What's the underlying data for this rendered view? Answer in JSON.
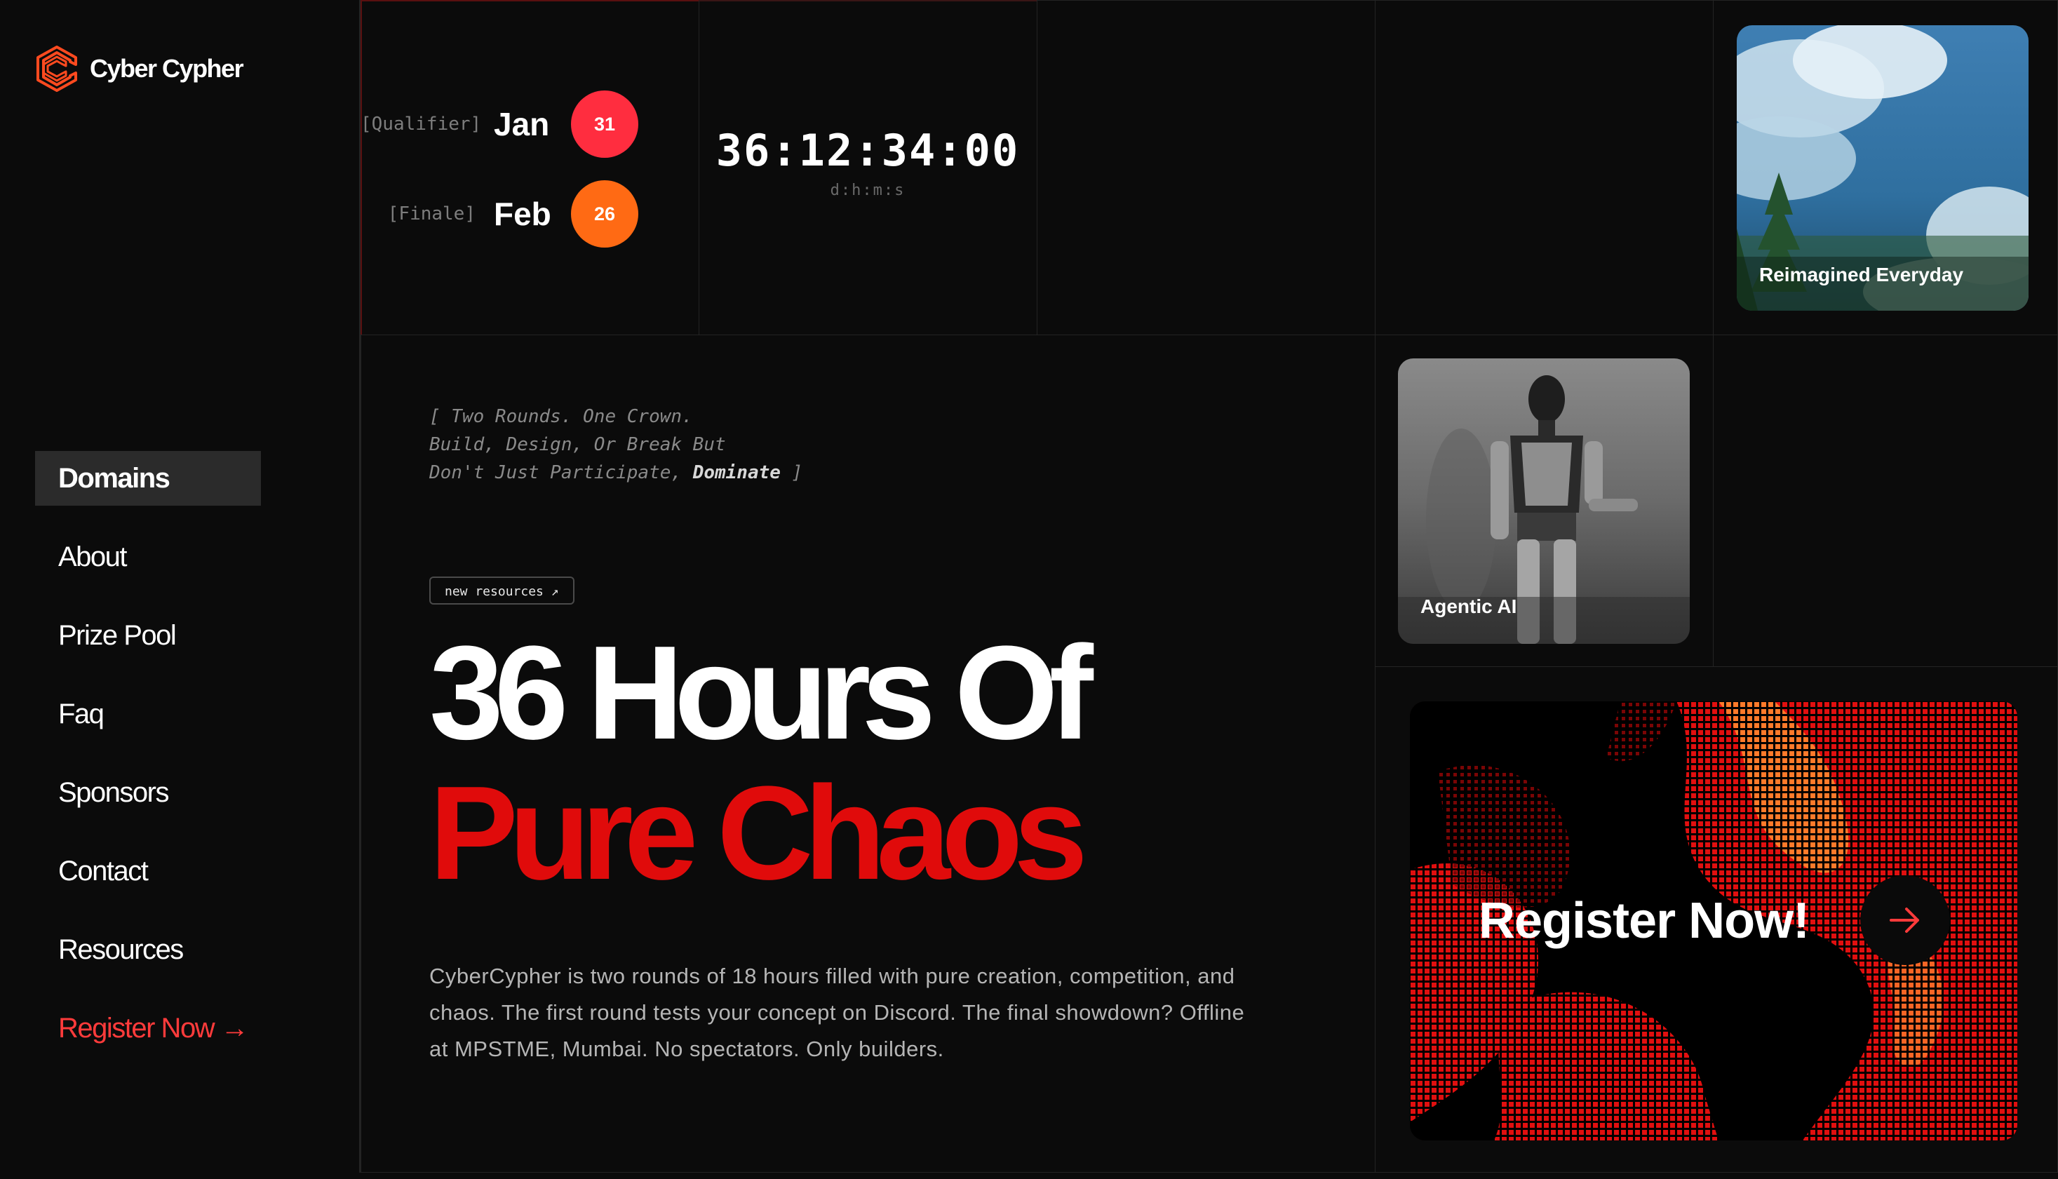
{
  "brand": {
    "name": "Cyber Cypher"
  },
  "nav": {
    "items": [
      {
        "label": "Domains"
      },
      {
        "label": "About"
      },
      {
        "label": "Prize Pool"
      },
      {
        "label": "Faq"
      },
      {
        "label": "Sponsors"
      },
      {
        "label": "Contact"
      },
      {
        "label": "Resources"
      }
    ],
    "register": "Register Now →"
  },
  "dates": {
    "qualifier": {
      "tag": "[Qualifier]",
      "month": "Jan",
      "day": "31"
    },
    "finale": {
      "tag": "[Finale]",
      "month": "Feb",
      "day": "26"
    }
  },
  "countdown": {
    "value": "36:12:34:00",
    "unit": "d:h:m:s"
  },
  "tagline": {
    "line1": "[ Two Rounds. One Crown.",
    "line2": "Build, Design, Or Break But",
    "line3_prefix": "Don't Just Participate,",
    "line3_bold": "Dominate",
    "line3_suffix": "]"
  },
  "resources_pill": "new resources ↗",
  "hero": {
    "line1": "36 Hours Of",
    "line2": "Pure Chaos",
    "description": "CyberCypher is two rounds of 18 hours filled with pure creation, competition, and chaos. The first round tests your concept on Discord. The final showdown? Offline at MPSTME, Mumbai. No spectators. Only builders."
  },
  "cards": {
    "reimagined": "Reimagined Everyday",
    "agentic": "Agentic AI",
    "register": "Register Now!"
  },
  "colors": {
    "background": "#0b0b0b",
    "accent_red": "#e00b0b",
    "qualifier_circle": "#ff2d3f",
    "finale_circle": "#ff6a14"
  }
}
